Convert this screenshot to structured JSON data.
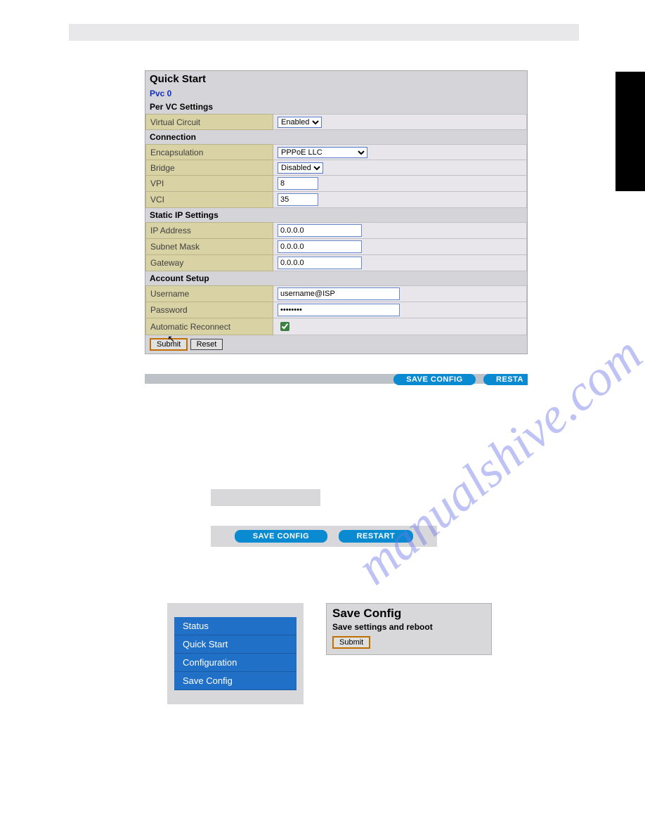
{
  "watermark": "manualshive.com",
  "quickStart": {
    "title": "Quick Start",
    "pvc": "Pvc 0",
    "sections": {
      "perVc": "Per VC Settings",
      "connection": "Connection",
      "staticIp": "Static IP Settings",
      "account": "Account Setup"
    },
    "labels": {
      "virtualCircuit": "Virtual Circuit",
      "encapsulation": "Encapsulation",
      "bridge": "Bridge",
      "vpi": "VPI",
      "vci": "VCI",
      "ipAddress": "IP Address",
      "subnetMask": "Subnet Mask",
      "gateway": "Gateway",
      "username": "Username",
      "password": "Password",
      "autoReconnect": "Automatic Reconnect"
    },
    "values": {
      "virtualCircuit": "Enabled",
      "encapsulation": "PPPoE LLC",
      "bridge": "Disabled",
      "vpi": "8",
      "vci": "35",
      "ipAddress": "0.0.0.0",
      "subnetMask": "0.0.0.0",
      "gateway": "0.0.0.0",
      "username": "username@ISP",
      "password": "••••••••",
      "autoReconnect": true
    },
    "buttons": {
      "submit": "Submit",
      "reset": "Reset"
    }
  },
  "footerButtons": {
    "saveConfig": "SAVE CONFIG",
    "restart": "RESTART",
    "restartShort": "RESTA"
  },
  "sidebar": {
    "items": [
      "Status",
      "Quick Start",
      "Configuration",
      "Save Config"
    ]
  },
  "saveConfigPanel": {
    "title": "Save Config",
    "subtitle": "Save settings and reboot",
    "submit": "Submit"
  }
}
